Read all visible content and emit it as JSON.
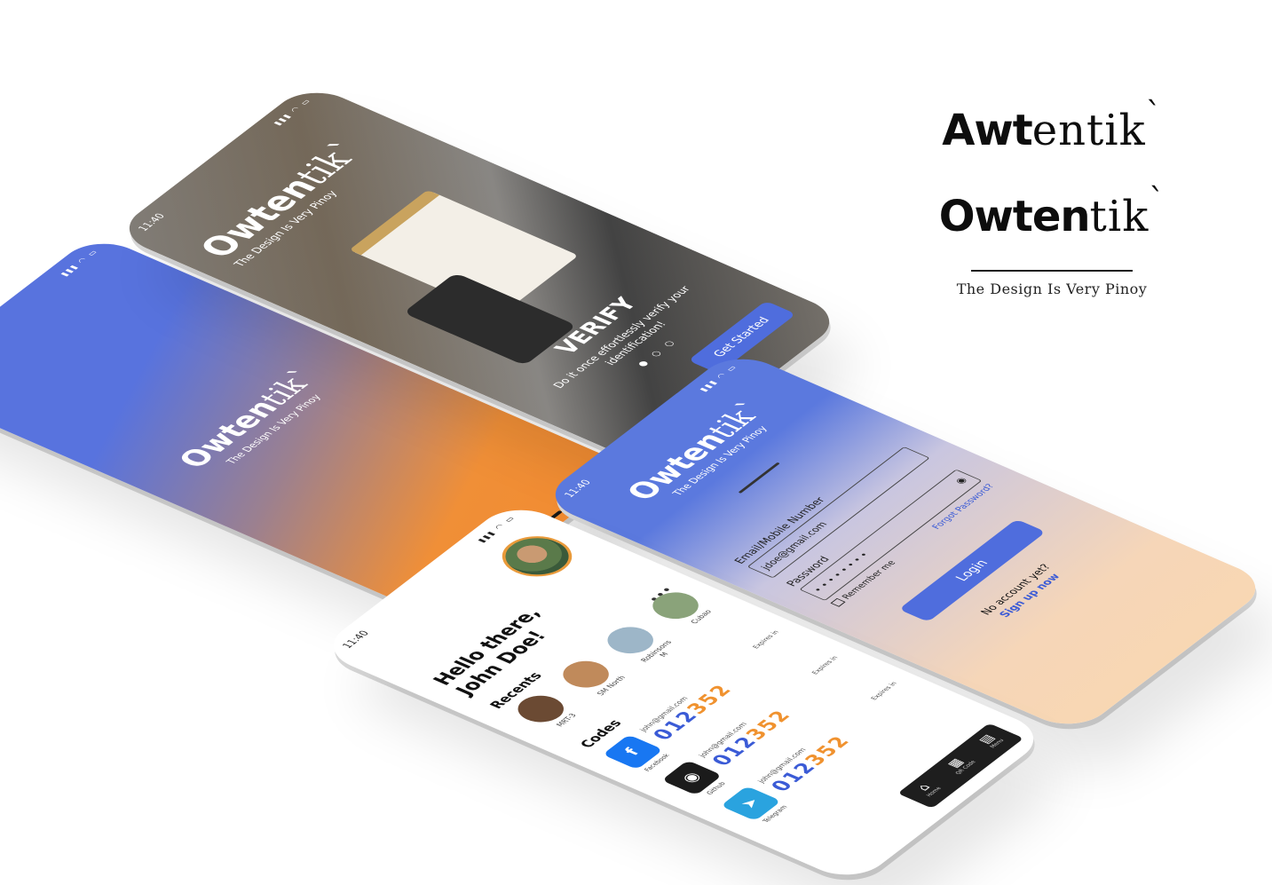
{
  "brand": {
    "logo1_bold": "Awt",
    "logo1_thin": "entik",
    "logo2_bold": "Owten",
    "logo2_thin": "tik",
    "tick": "`",
    "tagline": "The Design Is Very Pinoy"
  },
  "status": {
    "time": "11:40",
    "signal": "▮▮▮ ◠ ▭"
  },
  "splash": {
    "bold": "Owten",
    "thin": "tik",
    "tick": "`",
    "tagline": "The Design Is Very Pinoy"
  },
  "onboarding": {
    "bold": "Owten",
    "thin": "tik",
    "tick": "`",
    "tagline": "The Design Is Very Pinoy",
    "title": "VERIFY",
    "description": "Do it once effortlessly verify your identification!",
    "dots": "● ○ ○",
    "cta_label": "Get Started"
  },
  "login": {
    "bold": "Owten",
    "thin": "tik",
    "tick": "`",
    "tagline": "The Design Is Very Pinoy",
    "email_label": "Email/Mobile Number",
    "email_value": "jdoe@gmail.com",
    "password_label": "Password",
    "password_value": "• • • • • • • •",
    "forgot": "Forgot Password?",
    "remember": "Remember me",
    "login_label": "Login",
    "no_account": "No account yet?",
    "signup": "Sign up now"
  },
  "dashboard": {
    "greeting_line1": "Hello there,",
    "greeting_line2": "John Doe!",
    "recents_title": "Recents",
    "more": "•••",
    "recents": [
      {
        "label": "MRT-3"
      },
      {
        "label": "SM North"
      },
      {
        "label": "Robinsons M"
      },
      {
        "label": "Cubao"
      }
    ],
    "codes_title": "Codes",
    "codes": [
      {
        "app": "Facebook",
        "glyph": "f",
        "color": "#1877f2",
        "email": "john@gmail.com",
        "code_a": "012",
        "code_b": "352",
        "timer": "Expires in"
      },
      {
        "app": "Github",
        "glyph": "◉",
        "color": "#1b1b1b",
        "email": "john@gmail.com",
        "code_a": "012",
        "code_b": "352",
        "timer": "Expires in"
      },
      {
        "app": "Telegram",
        "glyph": "➤",
        "color": "#2aa3df",
        "email": "john@gmail.com",
        "code_a": "012",
        "code_b": "352",
        "timer": "Expires in"
      }
    ],
    "nav": [
      {
        "icon": "⌂",
        "label": "Home"
      },
      {
        "icon": "▦",
        "label": "QR Code"
      },
      {
        "icon": "▤",
        "label": "Menu"
      }
    ]
  }
}
